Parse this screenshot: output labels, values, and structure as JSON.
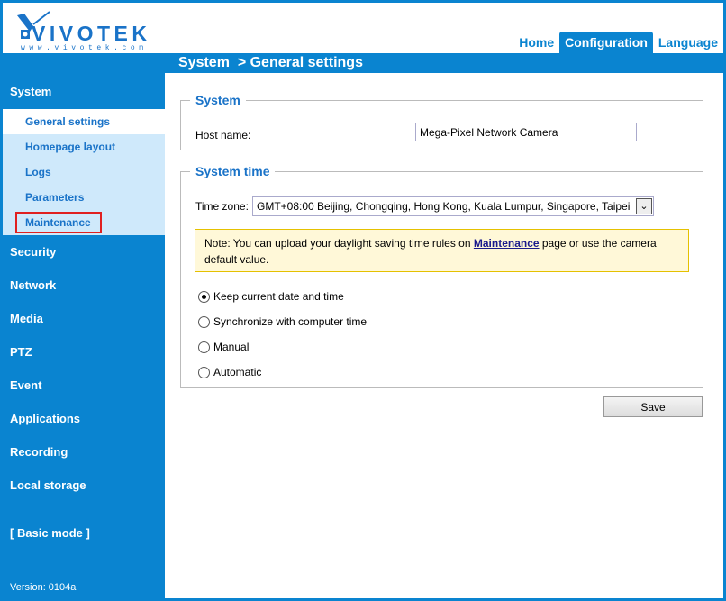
{
  "header": {
    "logo_text": "VIVOTEK",
    "logo_url_text": "www.vivotek.com",
    "tabs": [
      {
        "label": "Home"
      },
      {
        "label": "Configuration"
      },
      {
        "label": "Language"
      }
    ]
  },
  "breadcrumb": "System  > General settings",
  "sidebar": {
    "system": "System",
    "system_items": [
      {
        "label": "General settings"
      },
      {
        "label": "Homepage layout"
      },
      {
        "label": "Logs"
      },
      {
        "label": "Parameters"
      },
      {
        "label": "Maintenance"
      }
    ],
    "sections": [
      {
        "label": "Security"
      },
      {
        "label": "Network"
      },
      {
        "label": "Media"
      },
      {
        "label": "PTZ"
      },
      {
        "label": "Event"
      },
      {
        "label": "Applications"
      },
      {
        "label": "Recording"
      },
      {
        "label": "Local storage"
      }
    ],
    "basic_mode": "[ Basic mode ]",
    "version": "Version: 0104a"
  },
  "system_section": {
    "legend": "System",
    "host_label": "Host name:",
    "host_value": "Mega-Pixel Network Camera"
  },
  "time_section": {
    "legend": "System time",
    "tz_label": "Time zone:",
    "tz_value": "GMT+08:00 Beijing, Chongqing, Hong Kong, Kuala Lumpur, Singapore, Taipei",
    "note_prefix": "Note: You can upload your daylight saving time rules on ",
    "note_link": "Maintenance",
    "note_suffix": " page or use the camera default value.",
    "options": [
      {
        "label": "Keep current date and time",
        "checked": true
      },
      {
        "label": "Synchronize with computer time"
      },
      {
        "label": "Manual"
      },
      {
        "label": "Automatic"
      }
    ]
  },
  "save_label": "Save",
  "colors": {
    "brand_blue": "#0a84d0",
    "sub_bg": "#cfe9fb",
    "note_bg": "#fff8d8"
  }
}
